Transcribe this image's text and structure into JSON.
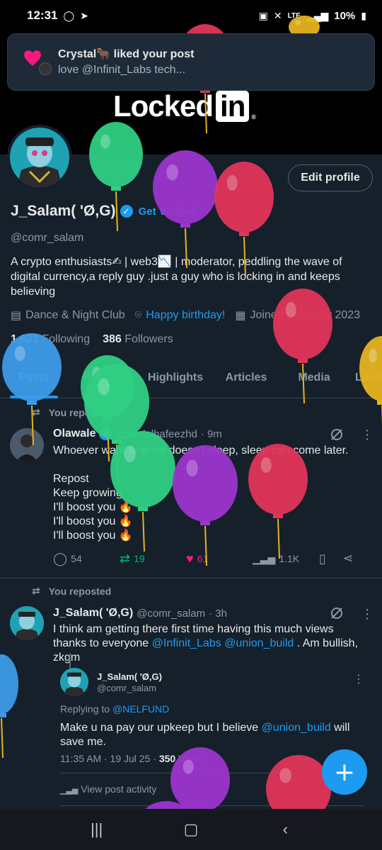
{
  "status_bar": {
    "time": "12:31",
    "network": "LTE",
    "battery": "10%"
  },
  "notification": {
    "title": "Crystal🐂 liked your post",
    "body": "love @Infinit_Labs tech..."
  },
  "banner": {
    "logo_text": "Locked",
    "logo_in": "in",
    "logo_reg": "®"
  },
  "profile": {
    "edit_label": "Edit profile",
    "name": "J_Salam( 'Ø,G)",
    "get_verified": "Get Verified",
    "handle": "@comr_salam",
    "bio": "A crypto enthusiasts✍ | web3📉 | moderator, peddling the wave of digital currency,a reply guy .just a guy who is locking in and keeps believing",
    "category": "Dance & Night Club",
    "birthday": "Happy birthday!",
    "joined": "Joined February 2023",
    "following_count": "1,621",
    "following_label": "Following",
    "followers_count": "386",
    "followers_label": "Followers"
  },
  "tabs": [
    "Posts",
    "Replies",
    "Highlights",
    "Articles",
    "Media",
    "Likes"
  ],
  "posts": [
    {
      "repost_label": "You reposted",
      "author": "Olawale",
      "handle": "@Abdulhafeezhd",
      "time": "· 9m",
      "text_lines": [
        "Whoever want to grow doesn't sleep, sleep can come later.",
        "",
        "Repost",
        "Keep growing",
        "I'll boost you 🔥",
        "I'll boost you 🔥",
        "I'll boost you 🔥"
      ],
      "replies": "54",
      "reposts": "19",
      "likes": "61",
      "views": "1.1K"
    },
    {
      "repost_label": "You reposted",
      "author": "J_Salam( 'Ø,G)",
      "handle": "@comr_salam",
      "time": "· 3h",
      "text_pre": "I think am getting there first time having this much views thanks to everyone ",
      "mention1": "@Infinit_Labs",
      "mention2": "@union_build",
      "text_post": " . Am bullish, zkgm",
      "quote": {
        "name": "J_Salam( 'Ø,G)",
        "handle": "@comr_salam",
        "replying_to": "Replying to ",
        "replying_handle": "@NELFUND",
        "text_pre": "Make u na pay our upkeep but I believe ",
        "mention": "@union_build",
        "text_post": " will save me.",
        "time_pre": "11:35 AM · 19 Jul 25 · ",
        "views": "350",
        "views_label": " Views",
        "activity": "View post activity"
      }
    }
  ],
  "fab_label": "+",
  "colors": {
    "accent": "#1d9bf0",
    "background": "#15202b",
    "repost": "#00ba7c",
    "like": "#f91880"
  }
}
